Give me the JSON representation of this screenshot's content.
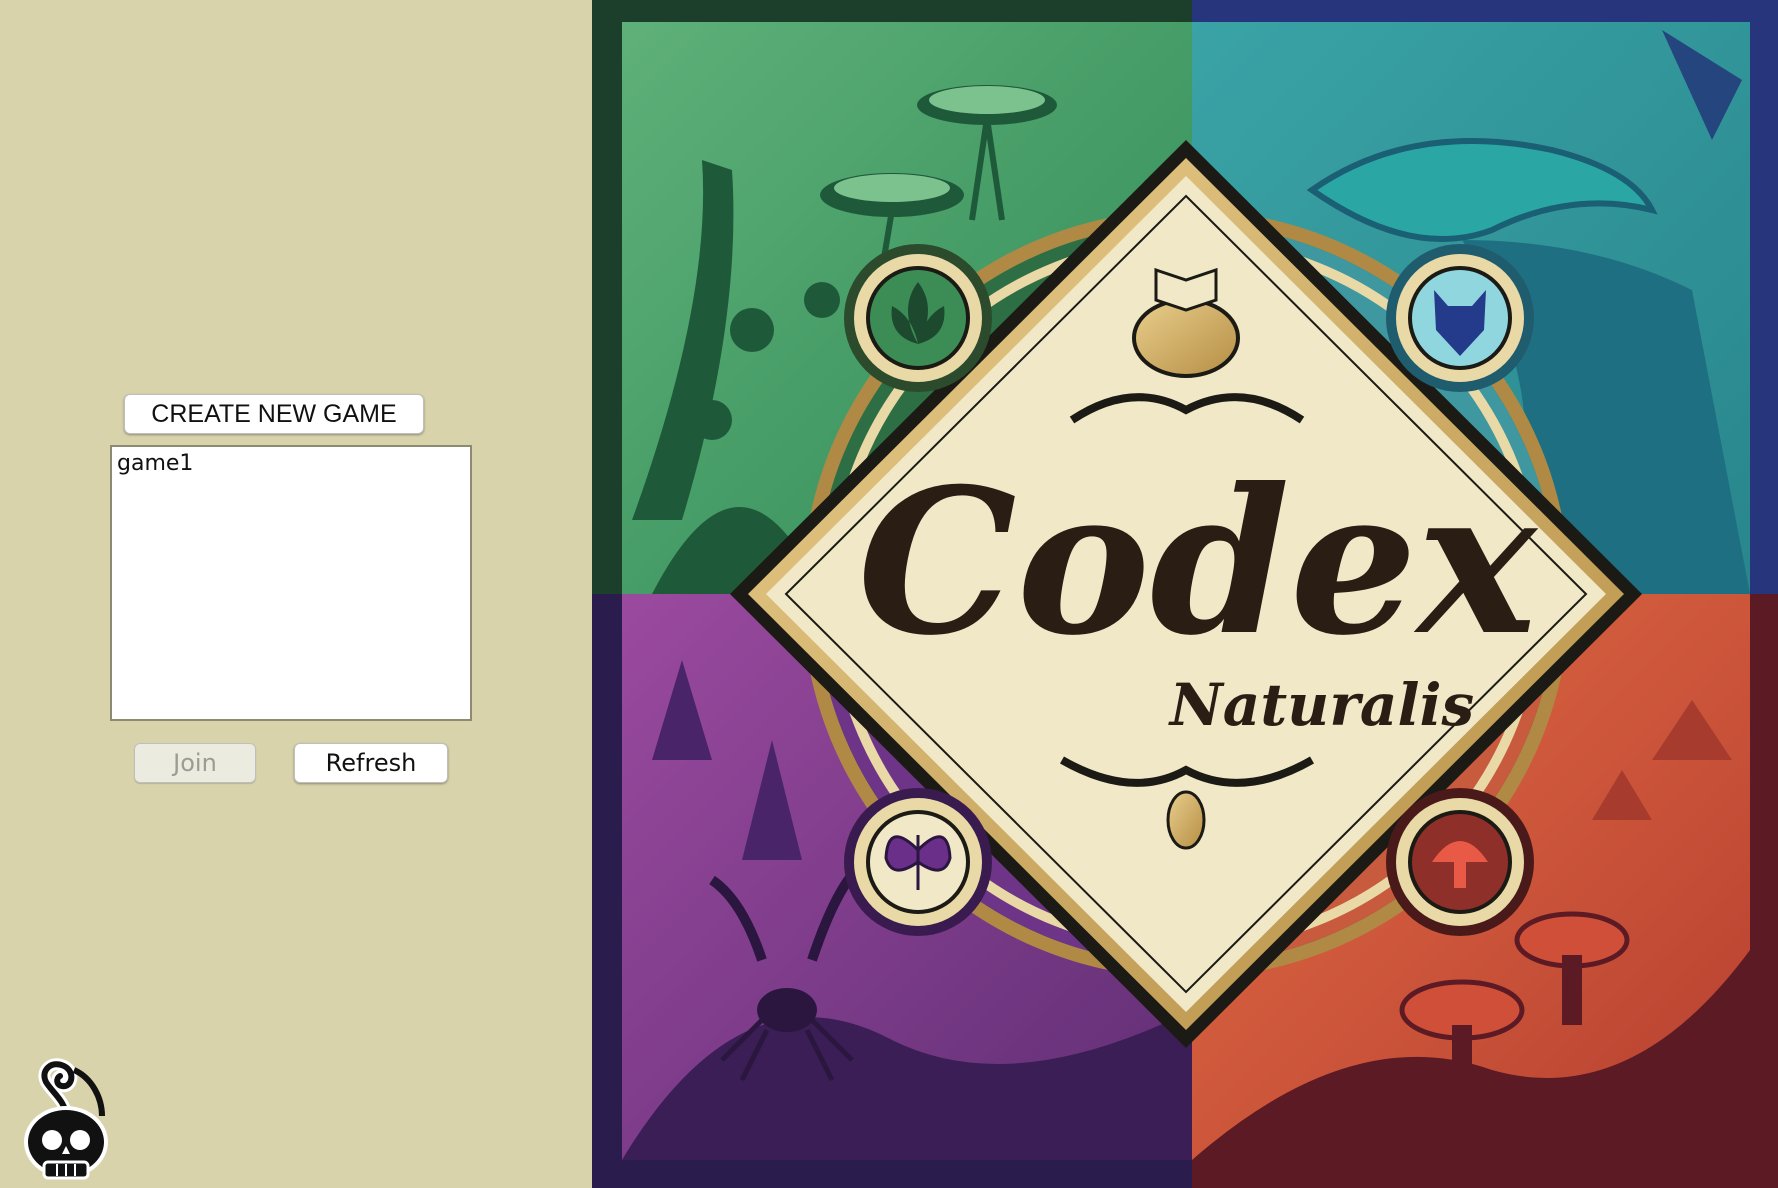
{
  "lobby": {
    "create_label": "CREATE NEW GAME",
    "games": [
      "game1"
    ],
    "join_label": "Join",
    "join_enabled": false,
    "refresh_label": "Refresh"
  },
  "logo": {
    "icon": "skull-icon"
  },
  "cover": {
    "title": "Codex",
    "subtitle": "Naturalis",
    "quadrant_colors": [
      "#3f9a63",
      "#2e8d8f",
      "#7b3c8c",
      "#d2553a"
    ],
    "emblems": [
      "leaf-icon",
      "fox-icon",
      "butterfly-icon",
      "mushroom-icon"
    ]
  }
}
